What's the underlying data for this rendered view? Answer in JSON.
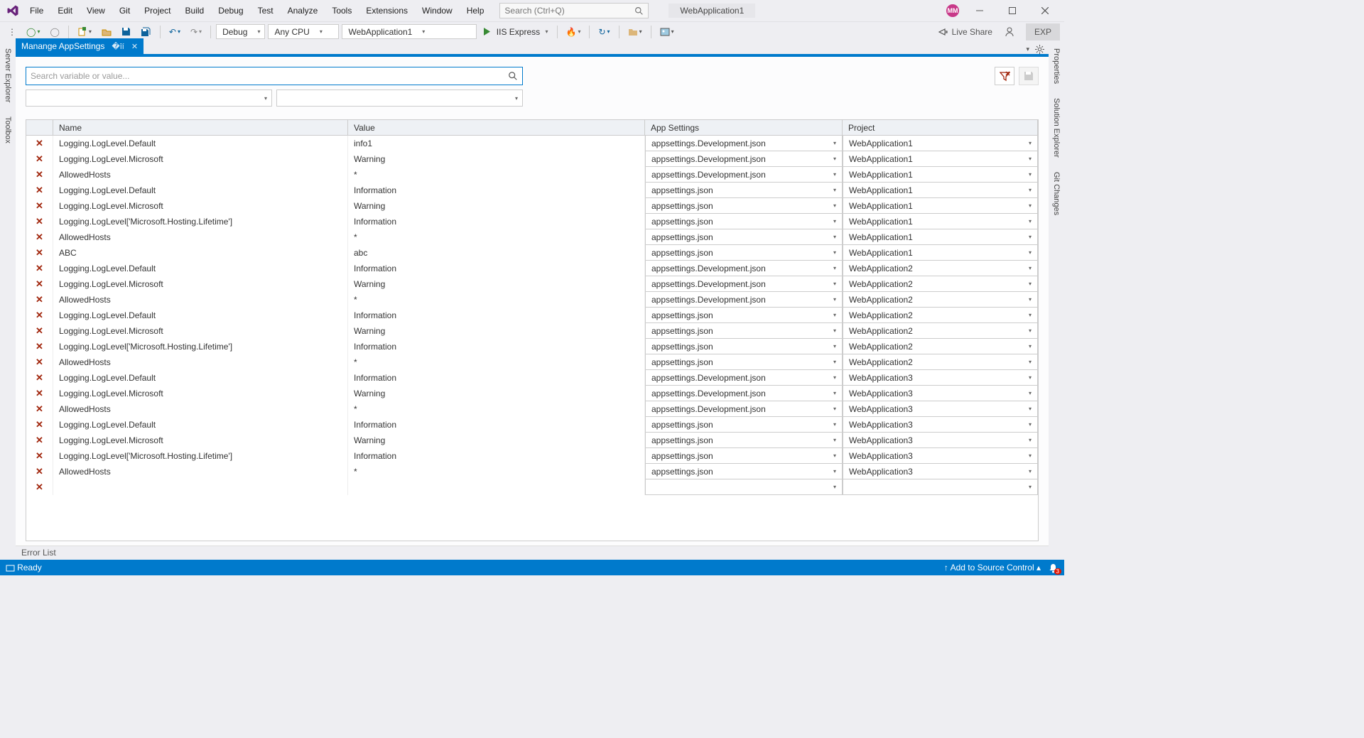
{
  "menu": [
    "File",
    "Edit",
    "View",
    "Git",
    "Project",
    "Build",
    "Debug",
    "Test",
    "Analyze",
    "Tools",
    "Extensions",
    "Window",
    "Help"
  ],
  "search_placeholder": "Search (Ctrl+Q)",
  "solution_name": "WebApplication1",
  "avatar": "MM",
  "toolbar": {
    "config": "Debug",
    "platform": "Any CPU",
    "startup": "WebApplication1",
    "run": "IIS Express",
    "live_share": "Live Share",
    "exp": "EXP"
  },
  "left_tabs": [
    "Server Explorer",
    "Toolbox"
  ],
  "right_tabs": [
    "Properties",
    "Solution Explorer",
    "Git Changes"
  ],
  "doc_tab": "Manange AppSettings",
  "filter_placeholder": "Search variable or value...",
  "columns": {
    "name": "Name",
    "value": "Value",
    "app": "App Settings",
    "project": "Project"
  },
  "rows": [
    {
      "name": "Logging.LogLevel.Default",
      "value": "info1",
      "app": "appsettings.Development.json",
      "project": "WebApplication1"
    },
    {
      "name": "Logging.LogLevel.Microsoft",
      "value": "Warning",
      "app": "appsettings.Development.json",
      "project": "WebApplication1"
    },
    {
      "name": "AllowedHosts",
      "value": "*",
      "app": "appsettings.Development.json",
      "project": "WebApplication1"
    },
    {
      "name": "Logging.LogLevel.Default",
      "value": "Information",
      "app": "appsettings.json",
      "project": "WebApplication1"
    },
    {
      "name": "Logging.LogLevel.Microsoft",
      "value": "Warning",
      "app": "appsettings.json",
      "project": "WebApplication1"
    },
    {
      "name": "Logging.LogLevel['Microsoft.Hosting.Lifetime']",
      "value": "Information",
      "app": "appsettings.json",
      "project": "WebApplication1"
    },
    {
      "name": "AllowedHosts",
      "value": "*",
      "app": "appsettings.json",
      "project": "WebApplication1"
    },
    {
      "name": "ABC",
      "value": "abc",
      "app": "appsettings.json",
      "project": "WebApplication1"
    },
    {
      "name": "Logging.LogLevel.Default",
      "value": "Information",
      "app": "appsettings.Development.json",
      "project": "WebApplication2"
    },
    {
      "name": "Logging.LogLevel.Microsoft",
      "value": "Warning",
      "app": "appsettings.Development.json",
      "project": "WebApplication2"
    },
    {
      "name": "AllowedHosts",
      "value": "*",
      "app": "appsettings.Development.json",
      "project": "WebApplication2"
    },
    {
      "name": "Logging.LogLevel.Default",
      "value": "Information",
      "app": "appsettings.json",
      "project": "WebApplication2"
    },
    {
      "name": "Logging.LogLevel.Microsoft",
      "value": "Warning",
      "app": "appsettings.json",
      "project": "WebApplication2"
    },
    {
      "name": "Logging.LogLevel['Microsoft.Hosting.Lifetime']",
      "value": "Information",
      "app": "appsettings.json",
      "project": "WebApplication2"
    },
    {
      "name": "AllowedHosts",
      "value": "*",
      "app": "appsettings.json",
      "project": "WebApplication2"
    },
    {
      "name": "Logging.LogLevel.Default",
      "value": "Information",
      "app": "appsettings.Development.json",
      "project": "WebApplication3"
    },
    {
      "name": "Logging.LogLevel.Microsoft",
      "value": "Warning",
      "app": "appsettings.Development.json",
      "project": "WebApplication3"
    },
    {
      "name": "AllowedHosts",
      "value": "*",
      "app": "appsettings.Development.json",
      "project": "WebApplication3"
    },
    {
      "name": "Logging.LogLevel.Default",
      "value": "Information",
      "app": "appsettings.json",
      "project": "WebApplication3"
    },
    {
      "name": "Logging.LogLevel.Microsoft",
      "value": "Warning",
      "app": "appsettings.json",
      "project": "WebApplication3"
    },
    {
      "name": "Logging.LogLevel['Microsoft.Hosting.Lifetime']",
      "value": "Information",
      "app": "appsettings.json",
      "project": "WebApplication3"
    },
    {
      "name": "AllowedHosts",
      "value": "*",
      "app": "appsettings.json",
      "project": "WebApplication3"
    }
  ],
  "error_list": "Error List",
  "status": {
    "ready": "Ready",
    "source_control": "Add to Source Control",
    "notif": "3"
  }
}
